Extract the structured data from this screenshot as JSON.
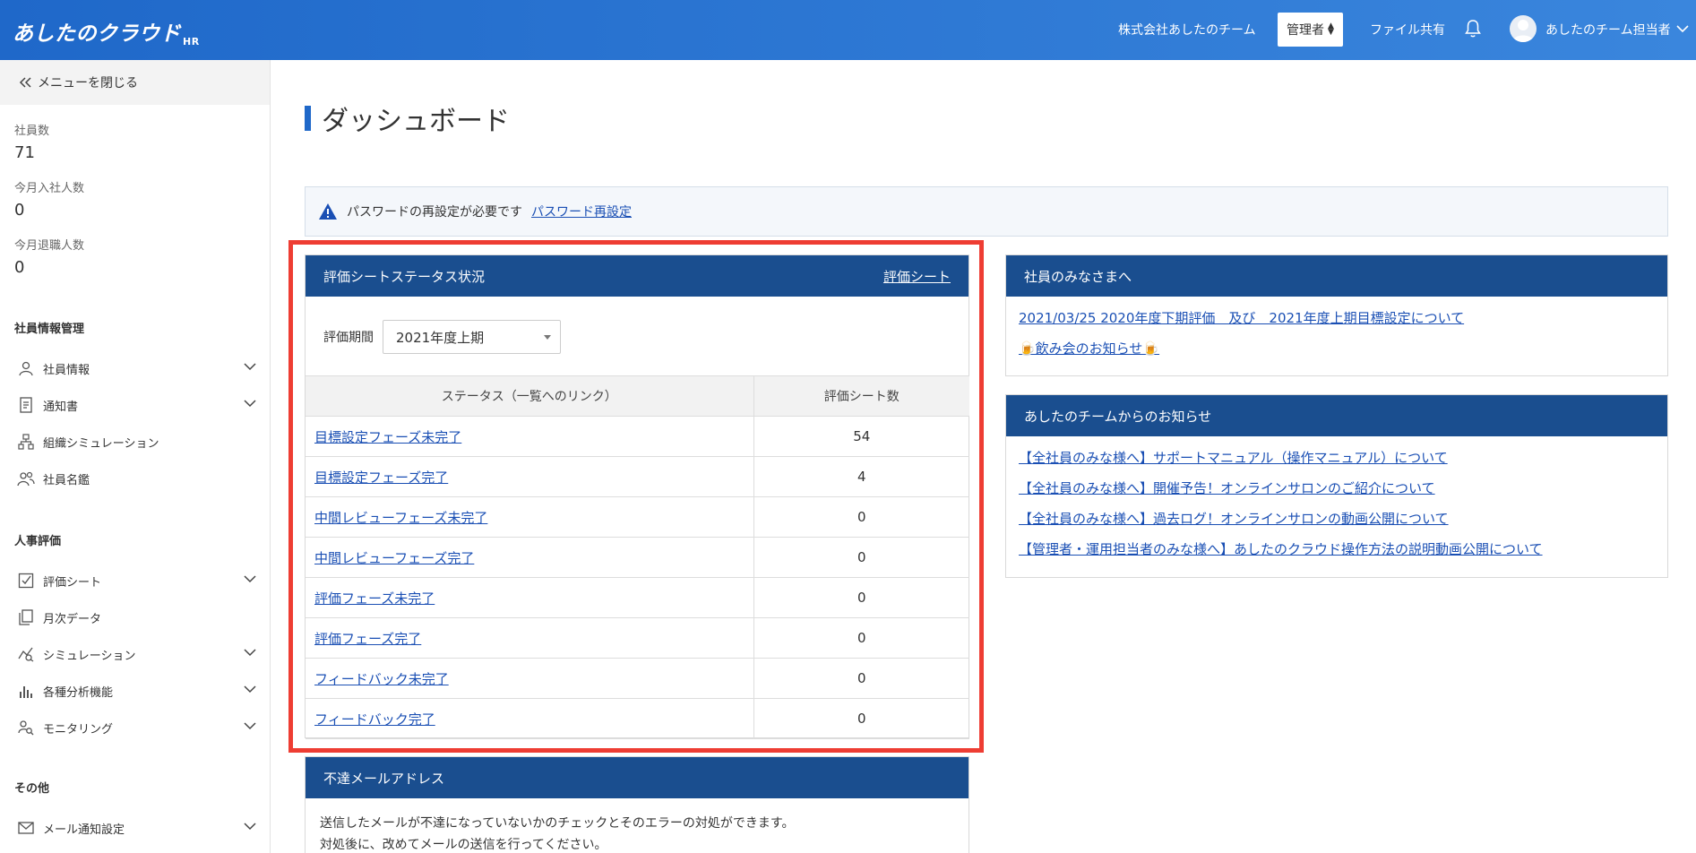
{
  "header": {
    "logo": "あしたのクラウド",
    "logo_sub": "HR",
    "company": "株式会社あしたのチーム",
    "role": "管理者",
    "file_share": "ファイル共有",
    "user_name": "あしたのチーム担当者"
  },
  "sidebar": {
    "close_menu": "メニューを閉じる",
    "stats": [
      {
        "label": "社員数",
        "value": "71"
      },
      {
        "label": "今月入社人数",
        "value": "0"
      },
      {
        "label": "今月退職人数",
        "value": "0"
      }
    ],
    "sections": {
      "employee": "社員情報管理",
      "hr_eval": "人事評価",
      "other": "その他"
    },
    "employee_items": [
      "社員情報",
      "通知書",
      "組織シミュレーション",
      "社員名鑑"
    ],
    "eval_items": [
      "評価シート",
      "月次データ",
      "シミュレーション",
      "各種分析機能",
      "モニタリング"
    ],
    "other_items": [
      "メール通知設定"
    ]
  },
  "main": {
    "title": "ダッシュボード",
    "alert": {
      "text": "パスワードの再設定が必要です",
      "link": "パスワード再設定"
    },
    "eval_panel": {
      "title": "評価シートステータス状況",
      "link": "評価シート",
      "period_label": "評価期間",
      "period_value": "2021年度上期",
      "col_status": "ステータス（一覧へのリンク）",
      "col_count": "評価シート数",
      "rows": [
        {
          "status": "目標設定フェーズ未完了",
          "count": "54"
        },
        {
          "status": "目標設定フェーズ完了",
          "count": "4"
        },
        {
          "status": "中間レビューフェーズ未完了",
          "count": "0"
        },
        {
          "status": "中間レビューフェーズ完了",
          "count": "0"
        },
        {
          "status": "評価フェーズ未完了",
          "count": "0"
        },
        {
          "status": "評価フェーズ完了",
          "count": "0"
        },
        {
          "status": "フィードバック未完了",
          "count": "0"
        },
        {
          "status": "フィードバック完了",
          "count": "0"
        }
      ]
    },
    "employee_notice": {
      "title": "社員のみなさまへ",
      "items": [
        "2021/03/25 2020年度下期評価　及び　2021年度上期目標設定について",
        "🍺飲み会のお知らせ🍺"
      ]
    },
    "team_notice": {
      "title": "あしたのチームからのお知らせ",
      "items": [
        "【全社員のみな様へ】サポートマニュアル（操作マニュアル）について",
        "【全社員のみな様へ】開催予告！オンラインサロンのご紹介について",
        "【全社員のみな様へ】過去ログ！オンラインサロンの動画公開について",
        "【管理者・運用担当者のみな様へ】あしたのクラウド操作方法の説明動画公開について"
      ]
    },
    "bounce_panel": {
      "title": "不達メールアドレス",
      "line1": "送信したメールが不達になっていないかのチェックとそのエラーの対処ができます。",
      "line2": "対処後に、改めてメールの送信を行ってください。"
    }
  },
  "colors": {
    "header_bg": "#1f68c9",
    "panel_header": "#1a4e8f",
    "link": "#1a4fb4",
    "highlight_frame": "#ee3d33"
  }
}
